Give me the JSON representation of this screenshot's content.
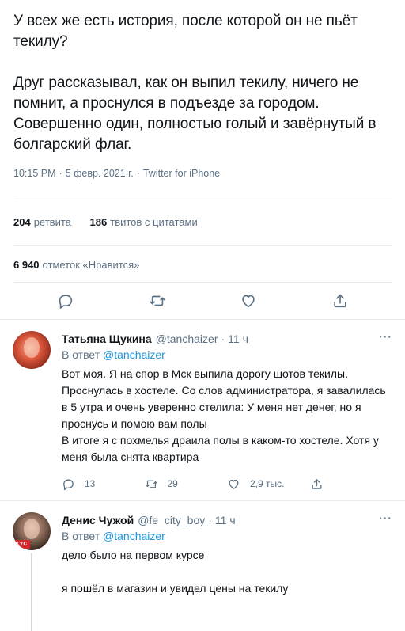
{
  "tweet": {
    "text": "У всех же есть история, после которой он не пьёт текилу?\n\nДруг рассказывал, как он выпил текилу, ничего не помнит, а проснулся в подъезде за городом. Совершенно один, полностью голый и завёрнутый в болгарский флаг.",
    "time": "10:15 PM",
    "date": "5 февр. 2021 г.",
    "source": "Twitter for iPhone",
    "retweets_count": "204",
    "retweets_label": "ретвита",
    "quotes_count": "186",
    "quotes_label": "твитов с цитатами",
    "likes_count": "6 940",
    "likes_label": "отметок «Нравится»"
  },
  "replies": [
    {
      "name": "Татьяна Щукина",
      "handle": "@tanchaizer",
      "time": "11 ч",
      "reply_to_label": "В ответ",
      "reply_to_handle": "@tanchaizer",
      "text": "Вот моя. Я на спор в Мск выпила дорогу шотов текилы. Проснулась в хостеле. Со слов администратора, я завалилась в 5 утра и очень уверенно стелила: У меня нет денег, но я проснусь и помою вам полы\nВ итоге я с похмелья драила полы в каком-то хостеле. Хотя у меня была снята квартира",
      "reply_count": "13",
      "retweet_count": "29",
      "like_count": "2,9 тыс."
    },
    {
      "name": "Денис Чужой",
      "handle": "@fe_city_boy",
      "time": "11 ч",
      "reply_to_label": "В ответ",
      "reply_to_handle": "@tanchaizer",
      "text": "дело было на первом курсе\n\nя пошёл в магазин и увидел цены на текилу",
      "avatar_badge": "KYC"
    }
  ],
  "icons": [
    "reply-icon",
    "retweet-icon",
    "like-icon",
    "share-icon",
    "more-icon"
  ],
  "colors": {
    "text": "#0f1419",
    "secondary": "#5b7083",
    "link": "#1b95e0",
    "divider": "#e6ecf0"
  }
}
